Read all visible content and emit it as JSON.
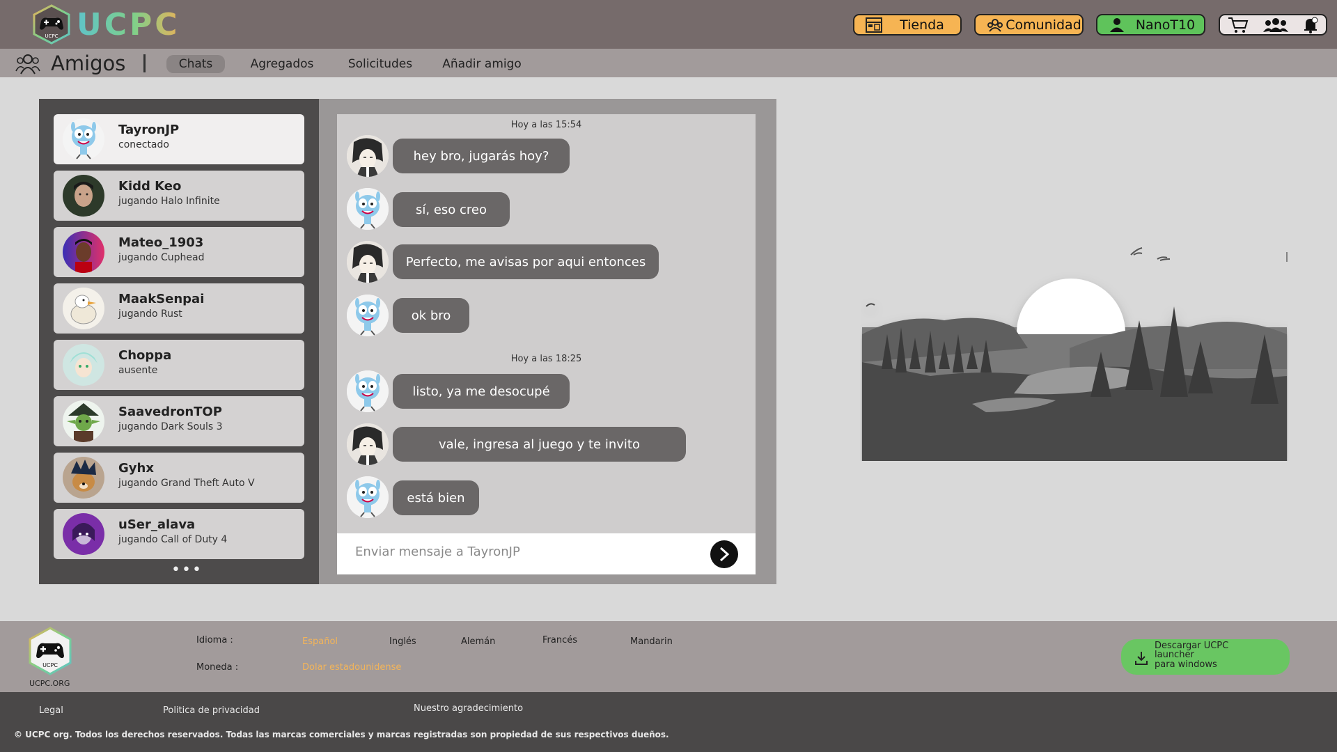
{
  "app": {
    "brand": "UCPC",
    "brand_colors": [
      "#5fc3c8",
      "#7fd08a",
      "#e6b25a"
    ]
  },
  "header": {
    "store_label": "Tienda",
    "community_label": "Comunidad",
    "user_label": "NanoT10",
    "icons": [
      "cart-icon",
      "friends-icon",
      "notification-icon"
    ]
  },
  "subnav": {
    "title": "Amigos",
    "tabs": [
      {
        "label": "Chats",
        "active": true
      },
      {
        "label": "Agregados"
      },
      {
        "label": "Solicitudes"
      },
      {
        "label": "Añadir amigo"
      }
    ]
  },
  "friends": [
    {
      "name": "TayronJP",
      "status": "conectado",
      "active": true
    },
    {
      "name": "Kidd Keo",
      "status": "jugando Halo Infinite"
    },
    {
      "name": "Mateo_1903",
      "status": "jugando Cuphead"
    },
    {
      "name": "MaakSenpai",
      "status": "jugando Rust"
    },
    {
      "name": "Choppa",
      "status": "ausente"
    },
    {
      "name": "SaavedronTOP",
      "status": "jugando Dark Souls 3"
    },
    {
      "name": "Gyhx",
      "status": "jugando Grand Theft Auto V"
    },
    {
      "name": "uSer_alava",
      "status": "jugando Call of Duty 4"
    }
  ],
  "friends_more": "•••",
  "chat": {
    "timestamps": [
      "Hoy a las 15:54",
      "Hoy a las 18:25"
    ],
    "messages": [
      {
        "from": "me",
        "text": "hey bro, jugarás hoy?"
      },
      {
        "from": "friend",
        "text": "sí, eso creo"
      },
      {
        "from": "me",
        "text": "Perfecto, me avisas por aqui entonces"
      },
      {
        "from": "friend",
        "text": "ok bro"
      },
      {
        "from": "friend",
        "text": "listo, ya me desocupé"
      },
      {
        "from": "me",
        "text": "vale, ingresa al juego y te invito"
      },
      {
        "from": "friend",
        "text": "está bien"
      }
    ],
    "input_placeholder": "Enviar mensaje a TayronJP"
  },
  "footer": {
    "org": "UCPC.ORG",
    "language_label": "Idioma :",
    "languages": [
      {
        "label": "Español",
        "selected": true
      },
      {
        "label": "Inglés"
      },
      {
        "label": "Alemán"
      },
      {
        "label": "Francés"
      },
      {
        "label": "Mandarin"
      }
    ],
    "currency_label": "Moneda :",
    "currency_value": "Dolar estadounidense",
    "download_title": "Descargar UCPC launcher",
    "download_sub": "para windows",
    "links": [
      "Legal",
      "Politica de privacidad",
      "Nuestro agradecimiento"
    ],
    "copyright": "© UCPC org. Todos los derechos reservados. Todas las marcas comerciales y marcas registradas son propiedad de sus respectivos dueños."
  }
}
